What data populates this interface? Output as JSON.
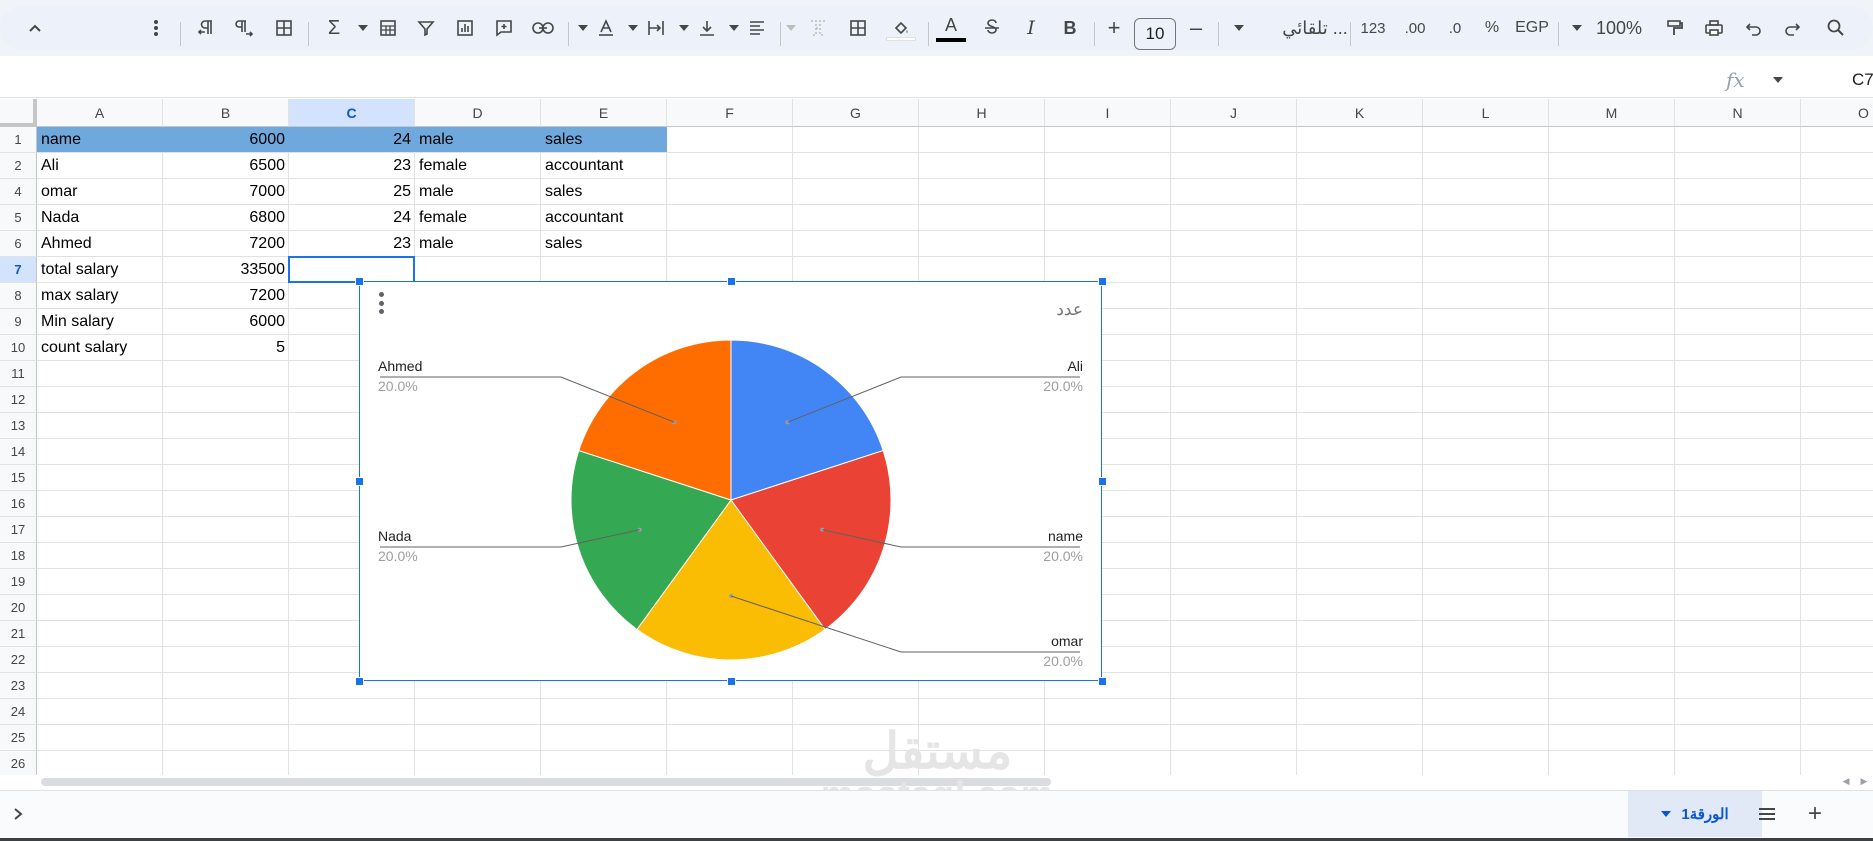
{
  "toolbar": {
    "zoom": "100%",
    "currency": "EGP",
    "percent": "%",
    "decimal_increase": ".00",
    "decimal_decrease": ".0",
    "number_format": "123",
    "font_name": "تلقائي ...",
    "font_size": "10",
    "text_color": "#000000"
  },
  "formula_bar": {
    "fx": "fx",
    "cell_ref": "C7"
  },
  "grid": {
    "columns": [
      "A",
      "B",
      "C",
      "D",
      "E",
      "F",
      "G",
      "H",
      "I",
      "J",
      "K",
      "L",
      "M",
      "N",
      "O"
    ],
    "selected_column": "C",
    "rows": [
      "1",
      "2",
      "4",
      "5",
      "6",
      "7",
      "8",
      "9",
      "10",
      "11",
      "12",
      "13",
      "14",
      "15",
      "16",
      "17",
      "18",
      "19",
      "20",
      "21",
      "22",
      "23",
      "24",
      "25",
      "26"
    ],
    "selected_row": "7",
    "header_fill": "#6fa8dc",
    "data": [
      [
        "name",
        "6000",
        "24",
        "male",
        "sales"
      ],
      [
        "Ali",
        "6500",
        "23",
        "female",
        "accountant"
      ],
      [
        "omar",
        "7000",
        "25",
        "male",
        "sales"
      ],
      [
        "Nada",
        "6800",
        "24",
        "female",
        "accountant"
      ],
      [
        "Ahmed",
        "7200",
        "23",
        "male",
        "sales"
      ],
      [
        "total salary",
        "33500",
        "",
        "",
        ""
      ],
      [
        "max salary",
        "7200",
        "",
        "",
        ""
      ],
      [
        "Min salary",
        "6000",
        "",
        "",
        ""
      ],
      [
        "count salary",
        "5",
        "",
        "",
        ""
      ]
    ]
  },
  "chart_data": {
    "type": "pie",
    "title": "عدد",
    "categories": [
      "Ali",
      "name",
      "omar",
      "Nada",
      "Ahmed"
    ],
    "values": [
      1,
      1,
      1,
      1,
      1
    ],
    "percent_labels": [
      "20.0%",
      "20.0%",
      "20.0%",
      "20.0%",
      "20.0%"
    ],
    "colors": [
      "#4285f4",
      "#ea4335",
      "#fbbc04",
      "#34a853",
      "#ff6d01"
    ],
    "legend": "labeled slices"
  },
  "sheets": {
    "active_tab": "الورقة1"
  },
  "watermark": {
    "arabic": "مستقل",
    "latin": "mostaql.com"
  }
}
